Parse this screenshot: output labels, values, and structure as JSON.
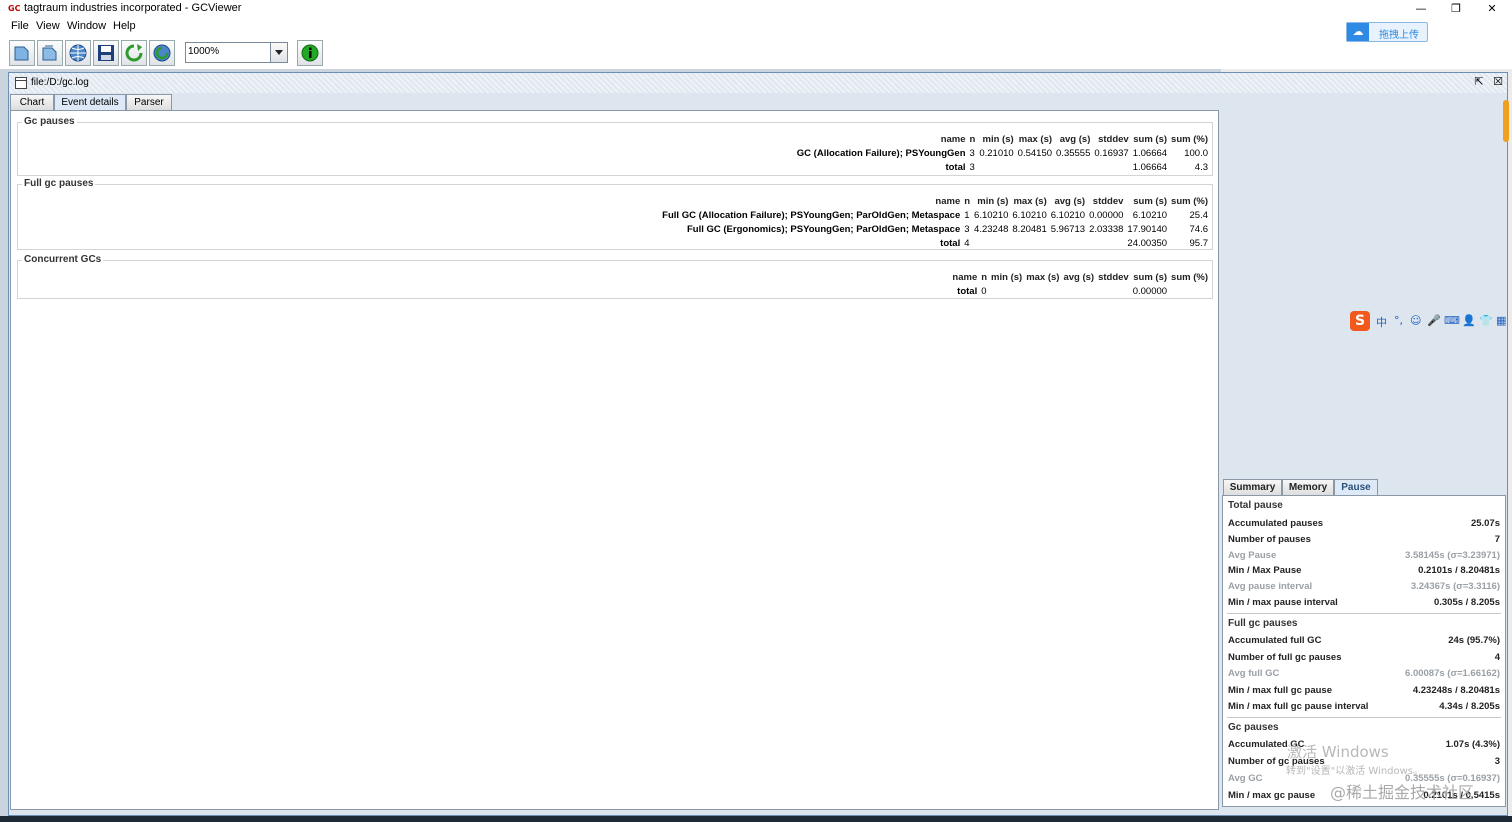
{
  "window": {
    "title": "tagtraum industries incorporated - GCViewer",
    "app_icon_text": "GC",
    "minimize": "—",
    "restore": "❐",
    "close": "✕"
  },
  "menu": [
    "File",
    "View",
    "Window",
    "Help"
  ],
  "toolbar": {
    "zoom_value": "1000%",
    "upload_label": "拖拽上传"
  },
  "internal_frame": {
    "title": "file:/D:/gc.log"
  },
  "tabs": [
    "Chart",
    "Event details",
    "Parser"
  ],
  "active_tab": "Event details",
  "gc_pauses": {
    "title": "Gc pauses",
    "headers": [
      "name",
      "n",
      "min (s)",
      "max (s)",
      "avg (s)",
      "stddev",
      "sum (s)",
      "sum (%)"
    ],
    "rows": [
      [
        "GC (Allocation Failure); PSYoungGen",
        "3",
        "0.21010",
        "0.54150",
        "0.35555",
        "0.16937",
        "1.06664",
        "100.0"
      ],
      [
        "total",
        "3",
        "",
        "",
        "",
        "",
        "1.06664",
        "4.3"
      ]
    ]
  },
  "full_gc_pauses": {
    "title": "Full gc pauses",
    "headers": [
      "name",
      "n",
      "min (s)",
      "max (s)",
      "avg (s)",
      "stddev",
      "sum (s)",
      "sum (%)"
    ],
    "rows": [
      [
        "Full GC (Allocation Failure); PSYoungGen; ParOldGen; Metaspace",
        "1",
        "6.10210",
        "6.10210",
        "6.10210",
        "0.00000",
        "6.10210",
        "25.4"
      ],
      [
        "Full GC (Ergonomics); PSYoungGen; ParOldGen; Metaspace",
        "3",
        "4.23248",
        "8.20481",
        "5.96713",
        "2.03338",
        "17.90140",
        "74.6"
      ],
      [
        "total",
        "4",
        "",
        "",
        "",
        "",
        "24.00350",
        "95.7"
      ]
    ]
  },
  "concurrent_gcs": {
    "title": "Concurrent GCs",
    "headers": [
      "name",
      "n",
      "min (s)",
      "max (s)",
      "avg (s)",
      "stddev",
      "sum (s)",
      "sum (%)"
    ],
    "rows": [
      [
        "total",
        "0",
        "",
        "",
        "",
        "",
        "0.00000",
        ""
      ]
    ]
  },
  "right_tabs": [
    "Summary",
    "Memory",
    "Pause"
  ],
  "right_active_tab": "Pause",
  "pause_panel": {
    "total_pause": {
      "title": "Total pause",
      "rows": [
        {
          "k": "Accumulated pauses",
          "v": "25.07s",
          "dim": false
        },
        {
          "k": "Number of pauses",
          "v": "7",
          "dim": false
        },
        {
          "k": "Avg Pause",
          "v": "3.58145s (σ=3.23971)",
          "dim": true
        },
        {
          "k": "Min / Max Pause",
          "v": "0.2101s / 8.20481s",
          "dim": false
        },
        {
          "k": "Avg pause interval",
          "v": "3.24367s (σ=3.3116)",
          "dim": true
        },
        {
          "k": "Min / max pause interval",
          "v": "0.305s / 8.205s",
          "dim": false
        }
      ]
    },
    "full_gc_pauses": {
      "title": "Full gc pauses",
      "rows": [
        {
          "k": "Accumulated full GC",
          "v": "24s (95.7%)",
          "dim": false
        },
        {
          "k": "Number of full gc pauses",
          "v": "4",
          "dim": false
        },
        {
          "k": "Avg full GC",
          "v": "6.00087s (σ=1.66162)",
          "dim": true
        },
        {
          "k": "Min / max full gc pause",
          "v": "4.23248s / 8.20481s",
          "dim": false
        },
        {
          "k": "Min / max full gc pause interval",
          "v": "4.34s / 8.205s",
          "dim": false
        }
      ]
    },
    "gc_pauses": {
      "title": "Gc pauses",
      "rows": [
        {
          "k": "Accumulated GC",
          "v": "1.07s (4.3%)",
          "dim": false
        },
        {
          "k": "Number of gc pauses",
          "v": "3",
          "dim": false
        },
        {
          "k": "Avg GC",
          "v": "0.35555s (σ=0.16937)",
          "dim": true
        },
        {
          "k": "Min / max gc pause",
          "v": "0.2101s / 0.5415s",
          "dim": false
        }
      ]
    }
  },
  "ime_bar": {
    "logo": "S",
    "glyphs": [
      "中",
      "°,",
      "☺",
      "🎤",
      "⌨",
      "👤",
      "👕",
      "▦"
    ]
  },
  "watermarks": {
    "activate_title": "激活 Windows",
    "activate_hint": "转到\"设置\"以激活 Windows。",
    "community": "@稀土掘金技术社区"
  }
}
